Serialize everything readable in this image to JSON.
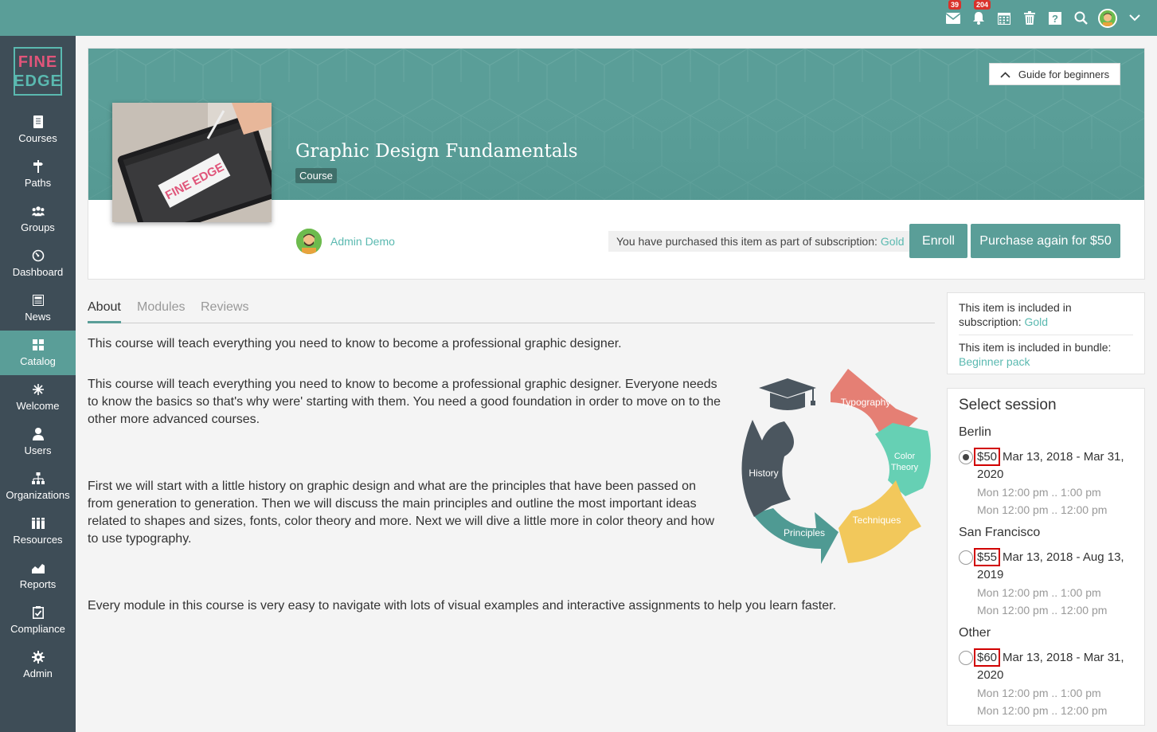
{
  "topbar": {
    "icons": [
      "mail-icon",
      "bell-icon",
      "calendar-icon",
      "trash-icon",
      "help-icon",
      "search-icon",
      "user-avatar",
      "chevron-down-icon"
    ],
    "mail_count": "39",
    "notification_count": "204"
  },
  "sidebar": {
    "logo_line1": "FINE",
    "logo_line2": "EDGE",
    "items": [
      {
        "label": "Courses",
        "icon": "book-icon"
      },
      {
        "label": "Paths",
        "icon": "signpost-icon"
      },
      {
        "label": "Groups",
        "icon": "groups-icon"
      },
      {
        "label": "Dashboard",
        "icon": "dashboard-icon"
      },
      {
        "label": "News",
        "icon": "news-icon"
      },
      {
        "label": "Catalog",
        "icon": "grid-icon"
      },
      {
        "label": "Welcome",
        "icon": "sparkle-icon"
      },
      {
        "label": "Users",
        "icon": "user-icon"
      },
      {
        "label": "Organizations",
        "icon": "org-chart-icon"
      },
      {
        "label": "Resources",
        "icon": "library-icon"
      },
      {
        "label": "Reports",
        "icon": "chart-icon"
      },
      {
        "label": "Compliance",
        "icon": "checklist-icon"
      },
      {
        "label": "Admin",
        "icon": "gear-icon"
      }
    ],
    "active": "Catalog"
  },
  "header": {
    "guide_label": "Guide for beginners",
    "title": "Graphic Design Fundamentals",
    "type_badge": "Course",
    "author": "Admin Demo",
    "subscription_note": "You have purchased this item as part of subscription:",
    "subscription_name": "Gold",
    "enroll_label": "Enroll",
    "purchase_label": "Purchase again for $50",
    "thumbnail_text": "FINE EDGE"
  },
  "tabs": [
    {
      "label": "About",
      "active": true
    },
    {
      "label": "Modules",
      "active": false
    },
    {
      "label": "Reviews",
      "active": false
    }
  ],
  "about": {
    "p1": "This course will teach everything you need to know to become a professional graphic designer.",
    "p2": "This course will teach everything you need to know to become a professional graphic designer. Everyone needs to know the basics so that's why were' starting with them. You need a good foundation in order to move on to the other more advanced courses.",
    "p3": "First we will start with a little history on graphic design and what are the principles that have been passed on from generation to generation. Then we will discuss the main principles and outline the most important ideas related to shapes and sizes, fonts, color theory and more. Next we will dive a little more in color theory and how to use typography.",
    "p4": "Every module in this course is very easy to navigate with lots of visual examples and interactive assignments to help you learn faster."
  },
  "diagram": {
    "labels": [
      "Typography",
      "Color Theory",
      "Techniques",
      "Principles",
      "History"
    ],
    "color_line1": "Color",
    "color_line2": "Theory",
    "colors": [
      "#e57f74",
      "#66d0b4",
      "#f2c85b",
      "#4f9a93",
      "#4b565f"
    ]
  },
  "right_panel": {
    "included_subscription_text": "This item is included in subscription:",
    "subscription_link": "Gold",
    "included_bundle_text": "This item is included in bundle:",
    "bundle_link": "Beginner pack"
  },
  "sessions": {
    "title": "Select session",
    "items": [
      {
        "city": "Berlin",
        "price": "$50",
        "dates": "Mar 13, 2018 - Mar 31, 2020",
        "time1": "Mon 12:00 pm .. 1:00 pm",
        "time2": "Mon 12:00 pm .. 12:00 pm",
        "selected": true
      },
      {
        "city": "San Francisco",
        "price": "$55",
        "dates": "Mar 13, 2018 - Aug 13, 2019",
        "time1": "Mon 12:00 pm .. 1:00 pm",
        "time2": "Mon 12:00 pm .. 12:00 pm",
        "selected": false
      },
      {
        "city": "Other",
        "price": "$60",
        "dates": "Mar 13, 2018 - Mar 31, 2020",
        "time1": "Mon 12:00 pm .. 1:00 pm",
        "time2": "Mon 12:00 pm .. 12:00 pm",
        "selected": false
      }
    ]
  }
}
